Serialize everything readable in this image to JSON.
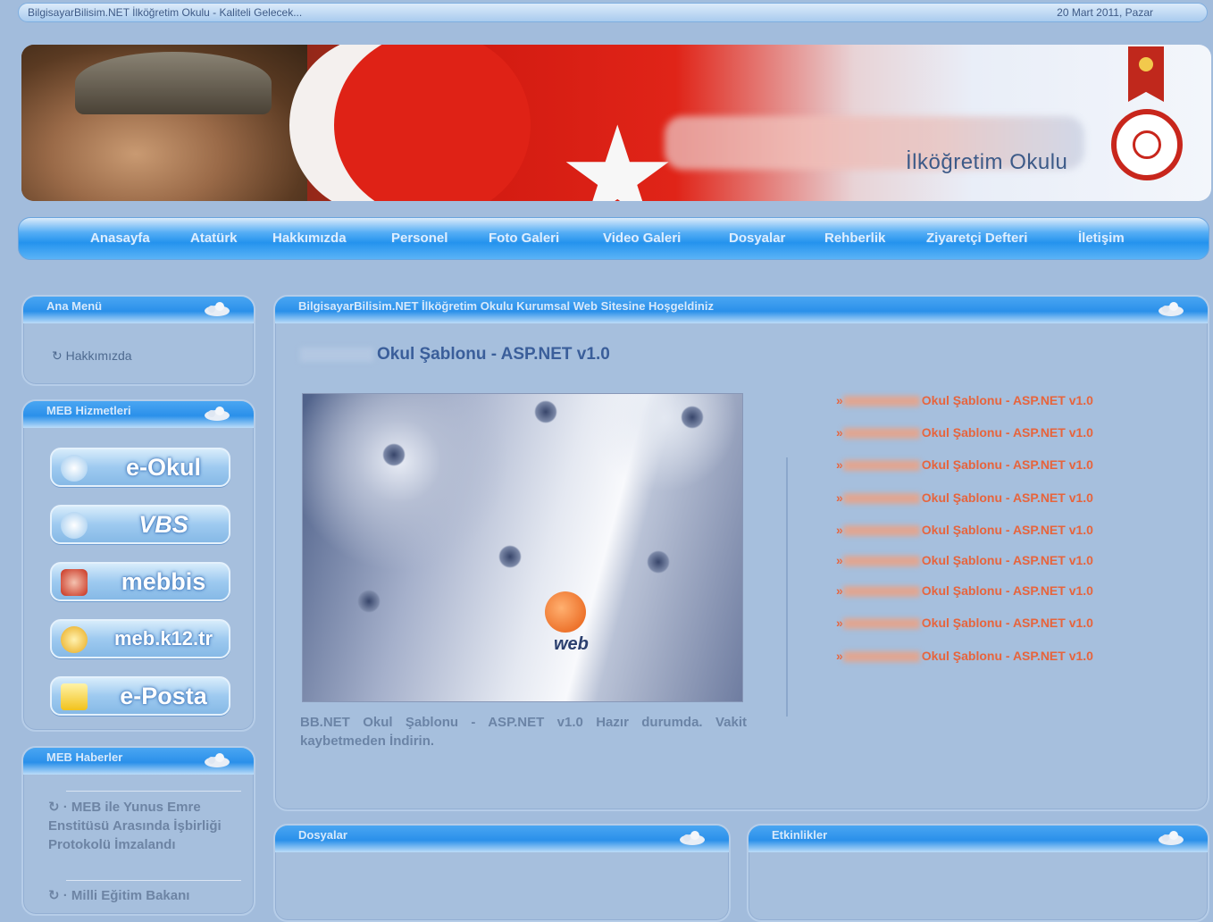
{
  "topbar": {
    "site_title": "BilgisayarBilisim.NET İlköğretim Okulu - Kaliteli Gelecek...",
    "date": "20 Mart 2011, Pazar"
  },
  "banner": {
    "school_name": "İlköğretim Okulu"
  },
  "nav": {
    "items": [
      "Anasayfa",
      "Atatürk",
      "Hakkımızda",
      "Personel",
      "Foto Galeri",
      "Video Galeri",
      "Dosyalar",
      "Rehberlik",
      "Ziyaretçi Defteri",
      "İletişim"
    ]
  },
  "left": {
    "ana_menu": {
      "title": "Ana Menü",
      "items": [
        "Hakkımızda"
      ]
    },
    "meb": {
      "title": "MEB Hizmetleri",
      "buttons": [
        "e-Okul",
        "VBS",
        "mebbis",
        "meb.k12.tr",
        "e-Posta"
      ]
    },
    "haberler": {
      "title": "MEB Haberler",
      "items": [
        "· MEB ile Yunus Emre Enstitüsü Arasında İşbirliği Protokolü İmzalandı",
        "· Milli Eğitim Bakanı"
      ]
    }
  },
  "main": {
    "welcome": "BilgisayarBilisim.NET İlköğretim Okulu Kurumsal Web Sitesine Hoşgeldiniz",
    "headline": "Okul Şablonu - ASP.NET v1.0",
    "description": "BB.NET Okul Şablonu - ASP.NET v1.0 Hazır durumda. Vakit kaybetmeden İndirin.",
    "photo_logo_text": "web",
    "links": [
      "Okul Şablonu - ASP.NET v1.0",
      "Okul Şablonu - ASP.NET v1.0",
      "Okul Şablonu - ASP.NET v1.0",
      "Okul Şablonu - ASP.NET v1.0",
      "Okul Şablonu - ASP.NET v1.0",
      "Okul Şablonu - ASP.NET v1.0",
      "Okul Şablonu - ASP.NET v1.0",
      "Okul Şablonu - ASP.NET v1.0",
      "Okul Şablonu - ASP.NET v1.0"
    ]
  },
  "bottom": {
    "dosyalar_title": "Dosyalar",
    "etkinlikler_title": "Etkinlikler"
  },
  "colors": {
    "background": "#a2bcdc",
    "nav_blue": "#2493ee",
    "link_orange": "#e7643c",
    "title_blue": "#3a5e9a"
  }
}
